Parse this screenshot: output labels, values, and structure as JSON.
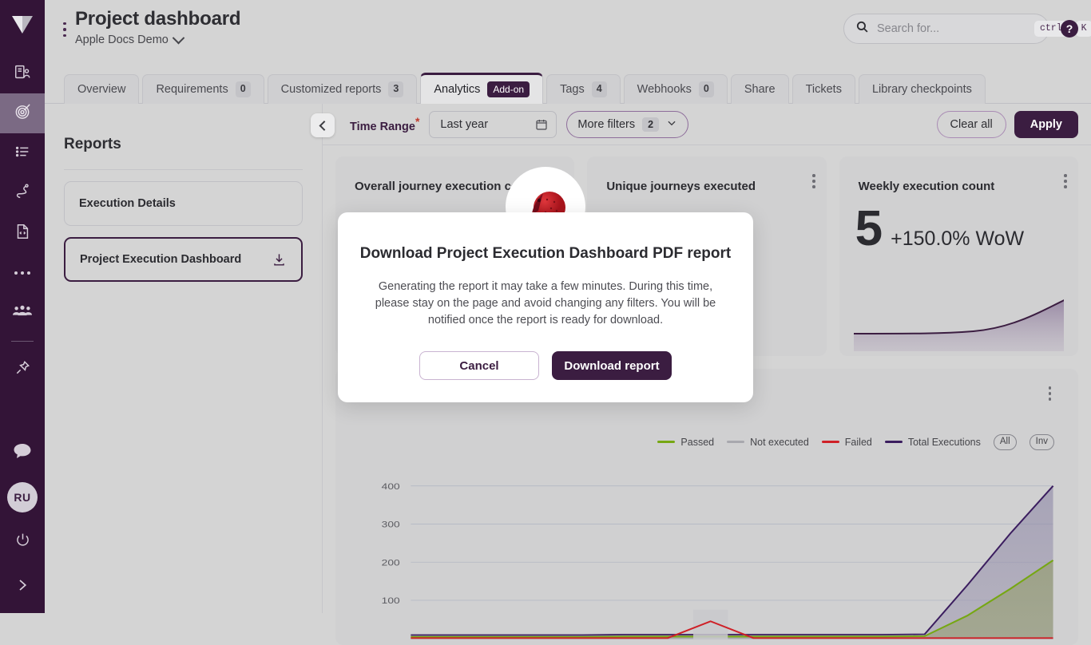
{
  "rail": {
    "logo": "vendor-logo",
    "items": [
      {
        "name": "projects-icon",
        "active": false
      },
      {
        "name": "target-icon",
        "active": true
      },
      {
        "name": "list-icon",
        "active": false
      },
      {
        "name": "journey-icon",
        "active": false
      },
      {
        "name": "code-file-icon",
        "active": false
      },
      {
        "name": "more-dots-icon",
        "active": false
      },
      {
        "name": "team-icon",
        "active": false
      },
      {
        "name": "pin-icon",
        "active": false
      }
    ],
    "bottom": {
      "chat_icon": "chat-bubble-icon",
      "avatar_initials": "RU",
      "power_icon": "power-icon",
      "expand_icon": "expand-rail-icon"
    }
  },
  "header": {
    "title": "Project dashboard",
    "project": "Apple Docs Demo",
    "kebab": "page-menu-icon"
  },
  "search": {
    "placeholder": "Search for...",
    "value": "",
    "shortcut_mod": "ctrl",
    "shortcut_key": "K",
    "help_glyph": "?"
  },
  "tabs": [
    {
      "label": "Overview",
      "count": null,
      "badge": null,
      "active": false
    },
    {
      "label": "Requirements",
      "count": "0",
      "badge": null,
      "active": false
    },
    {
      "label": "Customized reports",
      "count": "3",
      "badge": null,
      "active": false
    },
    {
      "label": "Analytics",
      "count": null,
      "badge": "Add-on",
      "active": true
    },
    {
      "label": "Tags",
      "count": "4",
      "badge": null,
      "active": false
    },
    {
      "label": "Webhooks",
      "count": "0",
      "badge": null,
      "active": false
    },
    {
      "label": "Share",
      "count": null,
      "badge": null,
      "active": false
    },
    {
      "label": "Tickets",
      "count": null,
      "badge": null,
      "active": false
    },
    {
      "label": "Library checkpoints",
      "count": null,
      "badge": null,
      "active": false
    }
  ],
  "reports_panel": {
    "title": "Reports",
    "items": [
      {
        "label": "Execution Details",
        "selected": false,
        "download": false
      },
      {
        "label": "Project Execution Dashboard",
        "selected": true,
        "download": true
      }
    ]
  },
  "filters": {
    "collapse_icon": "collapse-panel-icon",
    "time_range_label": "Time Range",
    "required_mark": "*",
    "time_range_value": "Last year",
    "calendar_icon": "calendar-icon",
    "more_filters_label": "More filters",
    "more_filters_count": "2",
    "chevron_icon": "chevron-down-icon",
    "clear_all_label": "Clear all",
    "apply_label": "Apply"
  },
  "cards": [
    {
      "title": "Overall journey execution count",
      "value": "",
      "delta": "",
      "kebab": false
    },
    {
      "title": "Unique journeys executed",
      "value": "",
      "delta": "",
      "kebab": true
    },
    {
      "title": "Weekly execution count",
      "value": "5",
      "delta": "+150.0% WoW",
      "kebab": true
    }
  ],
  "colors": {
    "brand_purple": "#3b1d41",
    "passed_green": "#76a713",
    "not_executed_grey": "#a8a8ae",
    "failed_red": "#cf2027",
    "total_purple": "#3b1d5f",
    "page_bg": "#d4d4d4",
    "card_bg": "#d0d0d1"
  },
  "chart_data": {
    "type": "area",
    "title": "",
    "xlabel": "",
    "ylabel": "",
    "ylim": [
      0,
      450
    ],
    "yticks": [
      100,
      200,
      300,
      400
    ],
    "grid": true,
    "legend_position": "top-right",
    "legend_controls": [
      "All",
      "Inv"
    ],
    "series": [
      {
        "name": "Passed",
        "color": "#76a713",
        "values": [
          4,
          4,
          4,
          4,
          4,
          5,
          5,
          5,
          5,
          5,
          5,
          5,
          6,
          60,
          130,
          205
        ]
      },
      {
        "name": "Not executed",
        "color": "#a8a8ae",
        "values": [
          0,
          0,
          0,
          0,
          0,
          0,
          0,
          0,
          0,
          0,
          0,
          0,
          0,
          0,
          0,
          0
        ]
      },
      {
        "name": "Failed",
        "color": "#cf2027",
        "values": [
          1,
          1,
          1,
          1,
          1,
          1,
          1,
          45,
          1,
          1,
          1,
          1,
          1,
          1,
          1,
          1
        ]
      },
      {
        "name": "Total Executions",
        "color": "#3b1d5f",
        "values": [
          9,
          9,
          9,
          9,
          9,
          10,
          10,
          10,
          10,
          10,
          10,
          10,
          11,
          140,
          275,
          400
        ]
      }
    ],
    "x": [
      1,
      2,
      3,
      4,
      5,
      6,
      7,
      8,
      9,
      10,
      11,
      12,
      13,
      14,
      15,
      16
    ]
  },
  "modal": {
    "illustration": "rocket-icon",
    "title": "Download Project Execution Dashboard PDF report",
    "body": "Generating the report it may take a few minutes. During this time, please stay on the page and avoid changing any filters. You will be notified once the report is ready for download.",
    "cancel_label": "Cancel",
    "download_label": "Download report"
  }
}
